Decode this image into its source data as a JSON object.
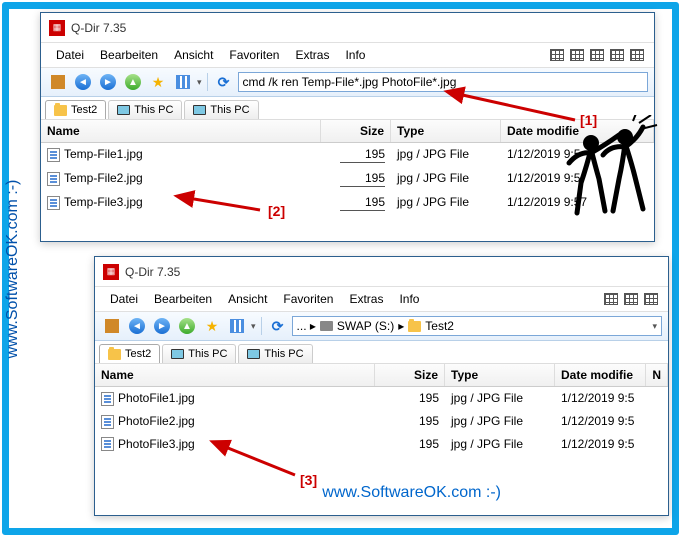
{
  "watermark_left": "www.SoftwareOK.com :-)",
  "watermark_bottom": "www.SoftwareOK.com :-)",
  "window1": {
    "title": "Q-Dir 7.35",
    "menu": [
      "Datei",
      "Bearbeiten",
      "Ansicht",
      "Favoriten",
      "Extras",
      "Info"
    ],
    "cmd_input": "cmd /k ren Temp-File*.jpg PhotoFile*.jpg",
    "tabs": [
      "Test2",
      "This PC",
      "This PC"
    ],
    "columns": {
      "name": "Name",
      "size": "Size",
      "type": "Type",
      "date": "Date modifie"
    },
    "rows": [
      {
        "name": "Temp-File1.jpg",
        "size": "195",
        "type": "jpg / JPG File",
        "date": "1/12/2019 9:5"
      },
      {
        "name": "Temp-File2.jpg",
        "size": "195",
        "type": "jpg / JPG File",
        "date": "1/12/2019 9:5"
      },
      {
        "name": "Temp-File3.jpg",
        "size": "195",
        "type": "jpg / JPG File",
        "date": "1/12/2019 9:57"
      }
    ]
  },
  "window2": {
    "title": "Q-Dir 7.35",
    "menu": [
      "Datei",
      "Bearbeiten",
      "Ansicht",
      "Favoriten",
      "Extras",
      "Info"
    ],
    "path": {
      "drive": "SWAP (S:)",
      "folder": "Test2"
    },
    "tabs": [
      "Test2",
      "This PC",
      "This PC"
    ],
    "columns": {
      "name": "Name",
      "size": "Size",
      "type": "Type",
      "date": "Date modifie",
      "extra": "N"
    },
    "rows": [
      {
        "name": "PhotoFile1.jpg",
        "size": "195",
        "type": "jpg / JPG File",
        "date": "1/12/2019 9:5"
      },
      {
        "name": "PhotoFile2.jpg",
        "size": "195",
        "type": "jpg / JPG File",
        "date": "1/12/2019 9:5"
      },
      {
        "name": "PhotoFile3.jpg",
        "size": "195",
        "type": "jpg / JPG File",
        "date": "1/12/2019 9:5"
      }
    ]
  },
  "labels": {
    "a1": "[1]",
    "a2": "[2]",
    "a3": "[3]"
  }
}
